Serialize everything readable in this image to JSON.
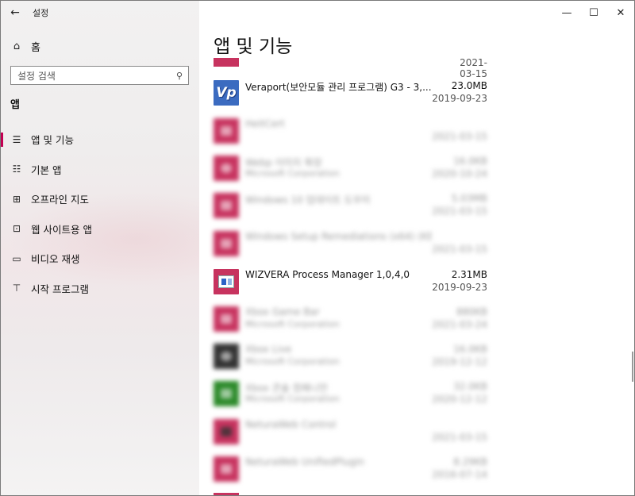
{
  "window": {
    "title": "설정",
    "controls": {
      "minimize": "—",
      "maximize": "☐",
      "close": "✕"
    }
  },
  "sidebar": {
    "home_label": "홈",
    "search_placeholder": "설정 검색",
    "section_title": "앱",
    "items": [
      {
        "label": "앱 및 기능",
        "icon": "apps-list-icon",
        "active": true
      },
      {
        "label": "기본 앱",
        "icon": "default-apps-icon",
        "active": false
      },
      {
        "label": "오프라인 지도",
        "icon": "offline-maps-icon",
        "active": false
      },
      {
        "label": "웹 사이트용 앱",
        "icon": "apps-for-websites-icon",
        "active": false
      },
      {
        "label": "비디오 재생",
        "icon": "video-playback-icon",
        "active": false
      },
      {
        "label": "시작 프로그램",
        "icon": "startup-icon",
        "active": false
      }
    ]
  },
  "main": {
    "page_title": "앱 및 기능",
    "top_partial_date": "2021-03-15",
    "apps": [
      {
        "name": "Veraport(보안모듈 관리 프로그램) G3 - 3,...",
        "publisher": "",
        "size": "23.0MB",
        "date": "2019-09-23",
        "blurred": false,
        "icon": "veraport-icon"
      },
      {
        "name": "HeitCert",
        "publisher": "",
        "size": "",
        "date": "2021-03-15",
        "blurred": true,
        "icon": "app-icon"
      },
      {
        "name": "Webp 이미지 확장",
        "publisher": "Microsoft Corporation",
        "size": "16.0KB",
        "date": "2020-10-24",
        "blurred": true,
        "icon": "webp-icon"
      },
      {
        "name": "Windows 10 업데이트 도우미",
        "publisher": "",
        "size": "5.03MB",
        "date": "2021-03-15",
        "blurred": true,
        "icon": "app-icon"
      },
      {
        "name": "Windows Setup Remediations (x64) (KB40...",
        "publisher": "",
        "size": "",
        "date": "2021-03-15",
        "blurred": true,
        "icon": "app-icon"
      },
      {
        "name": "WIZVERA Process Manager 1,0,4,0",
        "publisher": "",
        "size": "2.31MB",
        "date": "2019-09-23",
        "blurred": false,
        "icon": "wizvera-icon"
      },
      {
        "name": "Xbox Game Bar",
        "publisher": "Microsoft Corporation",
        "size": "880KB",
        "date": "2021-03-24",
        "blurred": true,
        "icon": "xbox-game-bar-icon"
      },
      {
        "name": "Xbox Live",
        "publisher": "Microsoft Corporation",
        "size": "16.0KB",
        "date": "2019-12-12",
        "blurred": true,
        "icon": "xbox-live-icon"
      },
      {
        "name": "Xbox 콘솔 컴패니언",
        "publisher": "Microsoft Corporation",
        "size": "32.0KB",
        "date": "2020-12-12",
        "blurred": true,
        "icon": "xbox-companion-icon"
      },
      {
        "name": "NeturaWeb Control",
        "publisher": "",
        "size": "",
        "date": "2021-03-15",
        "blurred": true,
        "icon": "app-icon"
      },
      {
        "name": "NeturaWeb UnifiedPlugin",
        "publisher": "",
        "size": "8.29KB",
        "date": "2016-07-14",
        "blurred": true,
        "icon": "app-icon"
      }
    ]
  }
}
